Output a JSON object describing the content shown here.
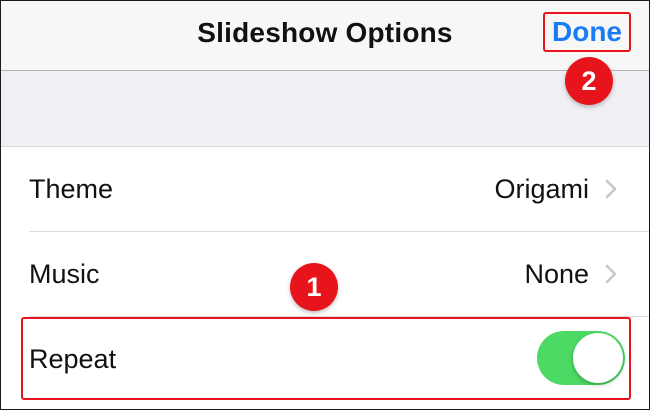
{
  "nav": {
    "title": "Slideshow Options",
    "done_label": "Done"
  },
  "settings": {
    "rows": [
      {
        "label": "Theme",
        "value": "Origami"
      },
      {
        "label": "Music",
        "value": "None"
      },
      {
        "label": "Repeat",
        "toggle_on": true
      }
    ]
  },
  "annotations": {
    "step_1": "1",
    "step_2": "2"
  },
  "colors": {
    "accent": "#1a7cf5",
    "toggle_on": "#4cd964",
    "annotation": "#e8141b",
    "grouped_background": "#efeff4"
  },
  "icons": {
    "disclosure": "chevron-right-icon"
  }
}
